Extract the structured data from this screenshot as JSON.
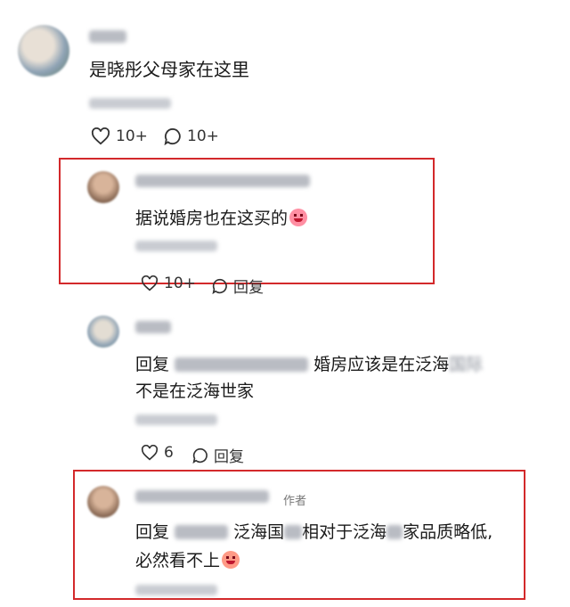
{
  "comments": [
    {
      "text": "是晓彤父母家在这里",
      "like_count": "10+",
      "reply_count": "10+"
    },
    {
      "text": "据说婚房也在这买的",
      "like_count": "10+",
      "reply_label": "回复"
    },
    {
      "text_line1": "回复",
      "text_line1_rest": "婚房应该是在泛海",
      "text_line2": "不是在泛海世家",
      "like_count": "6",
      "reply_label": "回复"
    },
    {
      "author_tag": "作者",
      "text_line1": "回复",
      "text_line1_mid": "泛海国",
      "text_line1_rest": "相对于泛海",
      "text_line1_end": "家品质略低,",
      "text_line2": "必然看不上"
    }
  ],
  "colors": {
    "highlight_border": "#d3292b",
    "meta_text": "#9aa0a6"
  },
  "icons": [
    "heart-icon",
    "comment-bubble-icon",
    "avatar",
    "emoji-icon"
  ]
}
